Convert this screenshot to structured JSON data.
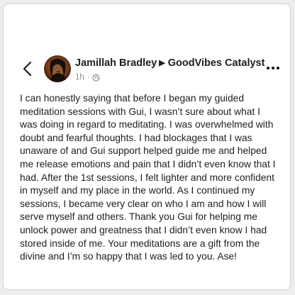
{
  "post": {
    "author": "Jamillah Bradley",
    "group": "GoodVibes Catalyst",
    "time": "1h",
    "separator": "·",
    "privacy_icon": "globe-icon",
    "back_icon": "chevron-left-icon",
    "more_icon": "more-dots-icon",
    "lines": [
      "I can honestly saying that before I began my guided",
      "meditation sessions with Gui, I wasn’t sure about what I",
      "was doing in regard to meditating. I was overwhelmed with",
      "doubt and fearful thoughts. I had blockages that I was",
      "unaware of and Gui support helped guide me and helped",
      "me release emotions and pain that I didn’t even know that I",
      "had. After the 1st sessions, I felt lighter and more confident",
      "in myself and my place in the world. As I continued my",
      "sessions, I became very clear on who I am and how I will",
      "serve myself and others. Thank you Gui for helping me",
      "unlock power and greatness that I didn’t even know I had",
      "stored inside of me. Your meditations are a gift from the",
      "divine and I’m so happy that I was led to you. Ase!"
    ]
  },
  "colors": {
    "text": "#1c1e21",
    "meta": "#8a8d91",
    "background": "#eeeeee",
    "card": "#ffffff"
  }
}
